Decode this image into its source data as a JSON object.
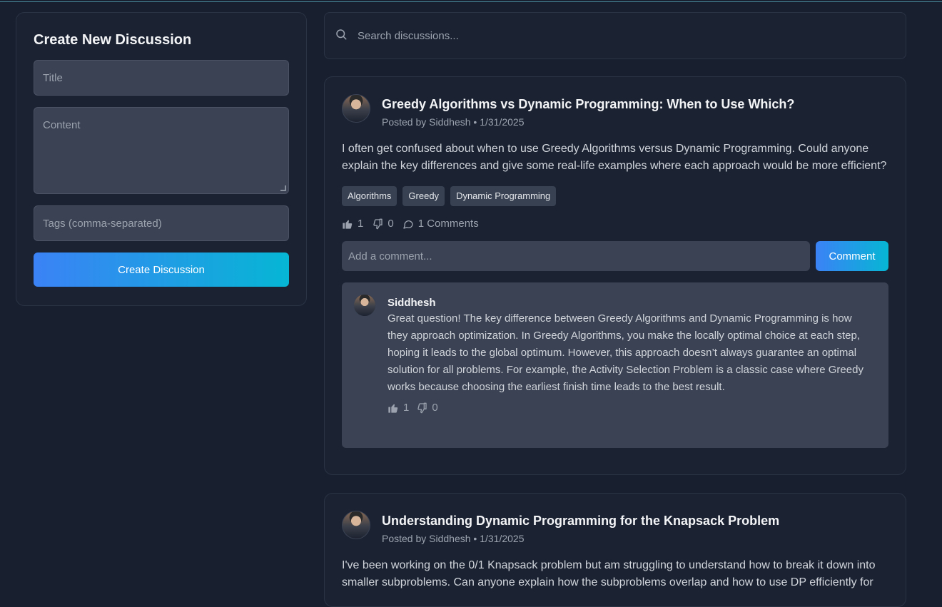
{
  "create": {
    "heading": "Create New Discussion",
    "title_placeholder": "Title",
    "content_placeholder": "Content",
    "tags_placeholder": "Tags (comma-separated)",
    "button_label": "Create Discussion"
  },
  "search": {
    "placeholder": "Search discussions..."
  },
  "posts": [
    {
      "title": "Greedy Algorithms vs Dynamic Programming: When to Use Which?",
      "meta": "Posted by Siddhesh • 1/31/2025",
      "body": "I often get confused about when to use Greedy Algorithms versus Dynamic Programming. Could anyone explain the key differences and give some real-life examples where each approach would be more efficient?",
      "tags": [
        "Algorithms",
        "Greedy",
        "Dynamic Programming"
      ],
      "likes": "1",
      "dislikes": "0",
      "comments_label": "1 Comments",
      "comment_placeholder": "Add a comment...",
      "comment_button": "Comment",
      "comment": {
        "author": "Siddhesh",
        "text": "Great question! The key difference between Greedy Algorithms and Dynamic Programming is how they approach optimization. In Greedy Algorithms, you make the locally optimal choice at each step, hoping it leads to the global optimum. However, this approach doesn’t always guarantee an optimal solution for all problems. For example, the Activity Selection Problem is a classic case where Greedy works because choosing the earliest finish time leads to the best result.",
        "likes": "1",
        "dislikes": "0"
      }
    },
    {
      "title": "Understanding Dynamic Programming for the Knapsack Problem",
      "meta": "Posted by Siddhesh • 1/31/2025",
      "body": "I've been working on the 0/1 Knapsack problem but am struggling to understand how to break it down into smaller subproblems. Can anyone explain how the subproblems overlap and how to use DP efficiently for"
    }
  ],
  "icons": {
    "search": "search-icon",
    "like": "thumbs-up-icon",
    "dislike": "thumbs-down-icon",
    "comments": "comment-bubble-icon"
  }
}
